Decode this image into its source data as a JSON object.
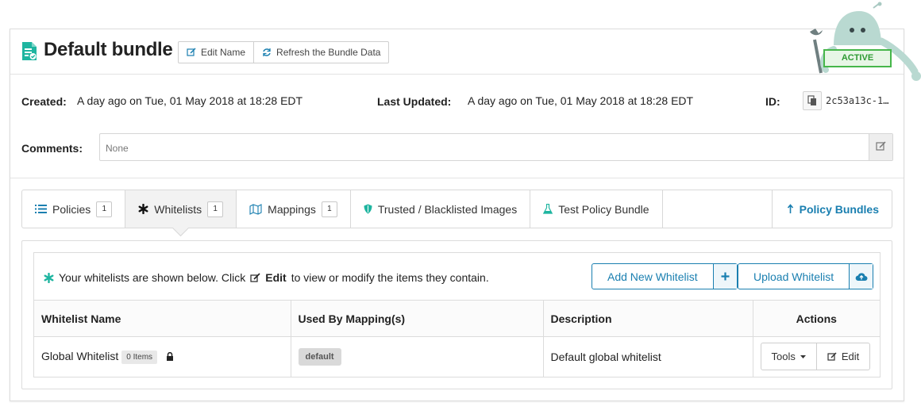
{
  "header": {
    "title": "Default bundle",
    "edit_name_label": "Edit Name",
    "refresh_label": "Refresh the Bundle Data",
    "status": "ACTIVE"
  },
  "meta": {
    "created_label": "Created:",
    "created_value": "A day ago on Tue, 01 May 2018 at 18:28 EDT",
    "updated_label": "Last Updated:",
    "updated_value": "A day ago on Tue, 01 May 2018 at 18:28 EDT",
    "id_label": "ID:",
    "id_value": "2c53a13c-1…",
    "comments_label": "Comments:",
    "comments_placeholder": "None"
  },
  "tabs": [
    {
      "label": "Policies",
      "count": "1",
      "icon": "list-icon"
    },
    {
      "label": "Whitelists",
      "count": "1",
      "icon": "asterisk-icon",
      "active": true
    },
    {
      "label": "Mappings",
      "count": "1",
      "icon": "map-icon"
    },
    {
      "label": "Trusted / Blacklisted Images",
      "icon": "shield-icon"
    },
    {
      "label": "Test Policy Bundle",
      "icon": "flask-icon"
    },
    {
      "label": "Policy Bundles",
      "icon": "upload-arrow-icon"
    }
  ],
  "whitelists": {
    "info_prefix": "Your whitelists are shown below. Click",
    "info_edit": "Edit",
    "info_suffix": "to view or modify the items they contain.",
    "add_label": "Add New Whitelist",
    "upload_label": "Upload Whitelist",
    "columns": [
      "Whitelist Name",
      "Used By Mapping(s)",
      "Description",
      "Actions"
    ],
    "rows": [
      {
        "name": "Global Whitelist",
        "items": "0 Items",
        "mapping": "default",
        "description": "Default global whitelist",
        "tools_label": "Tools",
        "edit_label": "Edit"
      }
    ]
  },
  "colors": {
    "accent": "#1a7fb0",
    "teal": "#1fb5a0",
    "active_green": "#46b64a"
  }
}
